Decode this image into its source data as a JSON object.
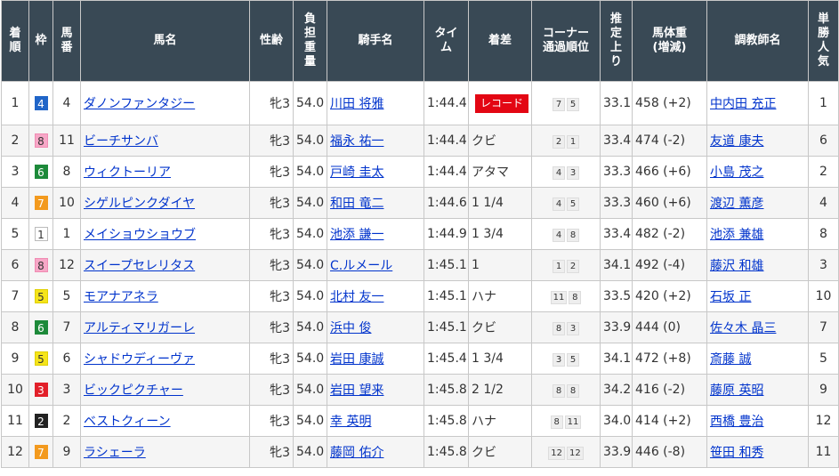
{
  "headers": {
    "rank": [
      "着",
      "順"
    ],
    "waku": [
      "枠"
    ],
    "umaban": [
      "馬",
      "番"
    ],
    "name": [
      "馬名"
    ],
    "sexage": [
      "性齢"
    ],
    "weight": [
      "負",
      "担",
      "重",
      "量"
    ],
    "jockey": [
      "騎手名"
    ],
    "time": [
      "タイ",
      "ム"
    ],
    "margin": [
      "着差"
    ],
    "corner": [
      "コーナー",
      "通過順位"
    ],
    "last3f": [
      "推",
      "定",
      "上",
      "り"
    ],
    "body": [
      "馬体重",
      "(増減)"
    ],
    "trainer": [
      "調教師名"
    ],
    "pop": [
      "単",
      "勝",
      "人",
      "気"
    ]
  },
  "rows": [
    {
      "rank": "1",
      "waku": "4",
      "umaban": "4",
      "name": "ダノンファンタジー",
      "sexage": "牝3",
      "weight": "54.0",
      "jockey": "川田 将雅",
      "time": "1:44.4",
      "margin": "",
      "record": "レコード",
      "corner": [
        "7",
        "5"
      ],
      "last3f": "33.1",
      "body": "458 (+2)",
      "trainer": "中内田 充正",
      "pop": "1"
    },
    {
      "rank": "2",
      "waku": "8",
      "umaban": "11",
      "name": "ビーチサンバ",
      "sexage": "牝3",
      "weight": "54.0",
      "jockey": "福永 祐一",
      "time": "1:44.4",
      "margin": "クビ",
      "corner": [
        "2",
        "1"
      ],
      "last3f": "33.4",
      "body": "474 (-2)",
      "trainer": "友道 康夫",
      "pop": "6"
    },
    {
      "rank": "3",
      "waku": "6",
      "umaban": "8",
      "name": "ウィクトーリア",
      "sexage": "牝3",
      "weight": "54.0",
      "jockey": "戸崎 圭太",
      "time": "1:44.4",
      "margin": "アタマ",
      "corner": [
        "4",
        "3"
      ],
      "last3f": "33.3",
      "body": "466 (+6)",
      "trainer": "小島 茂之",
      "pop": "2"
    },
    {
      "rank": "4",
      "waku": "7",
      "umaban": "10",
      "name": "シゲルピンクダイヤ",
      "sexage": "牝3",
      "weight": "54.0",
      "jockey": "和田 竜二",
      "time": "1:44.6",
      "margin": "1 1/4",
      "corner": [
        "4",
        "5"
      ],
      "last3f": "33.3",
      "body": "460 (+6)",
      "trainer": "渡辺 薫彦",
      "pop": "4"
    },
    {
      "rank": "5",
      "waku": "1",
      "umaban": "1",
      "name": "メイショウショウブ",
      "sexage": "牝3",
      "weight": "54.0",
      "jockey": "池添 謙一",
      "time": "1:44.9",
      "margin": "1 3/4",
      "corner": [
        "4",
        "8"
      ],
      "last3f": "33.4",
      "body": "482 (-2)",
      "trainer": "池添 兼雄",
      "pop": "8"
    },
    {
      "rank": "6",
      "waku": "8",
      "umaban": "12",
      "name": "スイープセレリタス",
      "sexage": "牝3",
      "weight": "54.0",
      "jockey": "C.ルメール",
      "time": "1:45.1",
      "margin": "1",
      "corner": [
        "1",
        "2"
      ],
      "last3f": "34.1",
      "body": "492 (-4)",
      "trainer": "藤沢 和雄",
      "pop": "3"
    },
    {
      "rank": "7",
      "waku": "5",
      "umaban": "5",
      "name": "モアナアネラ",
      "sexage": "牝3",
      "weight": "54.0",
      "jockey": "北村 友一",
      "time": "1:45.1",
      "margin": "ハナ",
      "corner": [
        "11",
        "8"
      ],
      "last3f": "33.5",
      "body": "420 (+2)",
      "trainer": "石坂 正",
      "pop": "10"
    },
    {
      "rank": "8",
      "waku": "6",
      "umaban": "7",
      "name": "アルティマリガーレ",
      "sexage": "牝3",
      "weight": "54.0",
      "jockey": "浜中 俊",
      "time": "1:45.1",
      "margin": "クビ",
      "corner": [
        "8",
        "3"
      ],
      "last3f": "33.9",
      "body": "444 (0)",
      "trainer": "佐々木 晶三",
      "pop": "7"
    },
    {
      "rank": "9",
      "waku": "5",
      "umaban": "6",
      "name": "シャドウディーヴァ",
      "sexage": "牝3",
      "weight": "54.0",
      "jockey": "岩田 康誠",
      "time": "1:45.4",
      "margin": "1 3/4",
      "corner": [
        "3",
        "5"
      ],
      "last3f": "34.1",
      "body": "472 (+8)",
      "trainer": "斎藤 誠",
      "pop": "5"
    },
    {
      "rank": "10",
      "waku": "3",
      "umaban": "3",
      "name": "ビックピクチャー",
      "sexage": "牝3",
      "weight": "54.0",
      "jockey": "岩田 望来",
      "time": "1:45.8",
      "margin": "2 1/2",
      "corner": [
        "8",
        "8"
      ],
      "last3f": "34.2",
      "body": "416 (-2)",
      "trainer": "藤原 英昭",
      "pop": "9"
    },
    {
      "rank": "11",
      "waku": "2",
      "umaban": "2",
      "name": "ベストクィーン",
      "sexage": "牝3",
      "weight": "54.0",
      "jockey": "幸 英明",
      "time": "1:45.8",
      "margin": "ハナ",
      "corner": [
        "8",
        "11"
      ],
      "last3f": "34.0",
      "body": "414 (+2)",
      "trainer": "西橋 豊治",
      "pop": "12"
    },
    {
      "rank": "12",
      "waku": "7",
      "umaban": "9",
      "name": "ラシェーラ",
      "sexage": "牝3",
      "weight": "54.0",
      "jockey": "藤岡 佑介",
      "time": "1:45.8",
      "margin": "クビ",
      "corner": [
        "12",
        "12"
      ],
      "last3f": "33.9",
      "body": "446 (-8)",
      "trainer": "笹田 和秀",
      "pop": "11"
    }
  ]
}
